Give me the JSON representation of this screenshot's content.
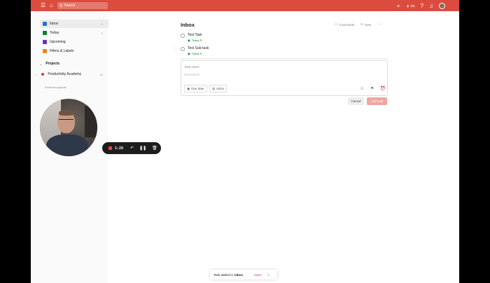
{
  "topbar": {
    "search_placeholder": "Search",
    "karma": "3/5"
  },
  "sidebar": {
    "items": [
      {
        "label": "Inbox",
        "count": "2",
        "color": "#246fe0"
      },
      {
        "label": "Today",
        "count": "2",
        "color": "#058527"
      },
      {
        "label": "Upcoming",
        "color": "#692fc2"
      },
      {
        "label": "Filters & Labels",
        "color": "#eb8909"
      }
    ],
    "projects_title": "Projects",
    "projects": [
      {
        "label": "Productivity Academy",
        "count": "10"
      }
    ],
    "archived_label": "Archived projects"
  },
  "main": {
    "title": "Inbox",
    "actions": {
      "comments": "Comments",
      "view": "View"
    },
    "tasks": [
      {
        "name": "Test Task",
        "date": "Today"
      },
      {
        "name": "Test Sub-task",
        "date": "Today"
      }
    ],
    "editor": {
      "name_placeholder": "Task name",
      "desc_placeholder": "Description",
      "due_date": "Due date",
      "project": "Inbox"
    },
    "cancel_label": "Cancel",
    "add_label": "Add task"
  },
  "toast": {
    "prefix": "Task added to",
    "target": "Inbox",
    "open": "Open"
  },
  "recorder": {
    "time": "1:28"
  }
}
